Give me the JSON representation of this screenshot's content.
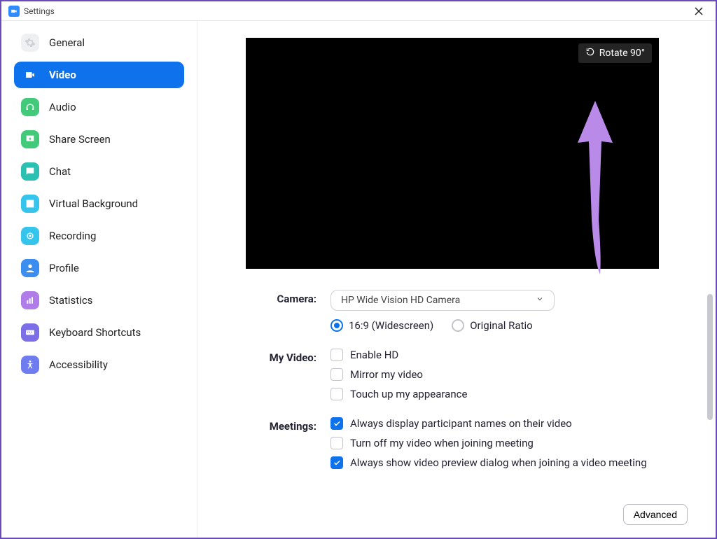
{
  "window": {
    "title": "Settings"
  },
  "sidebar": {
    "items": [
      {
        "key": "general",
        "label": "General"
      },
      {
        "key": "video",
        "label": "Video",
        "active": true
      },
      {
        "key": "audio",
        "label": "Audio"
      },
      {
        "key": "share",
        "label": "Share Screen"
      },
      {
        "key": "chat",
        "label": "Chat"
      },
      {
        "key": "vbg",
        "label": "Virtual Background"
      },
      {
        "key": "rec",
        "label": "Recording"
      },
      {
        "key": "profile",
        "label": "Profile"
      },
      {
        "key": "stats",
        "label": "Statistics"
      },
      {
        "key": "keys",
        "label": "Keyboard Shortcuts"
      },
      {
        "key": "access",
        "label": "Accessibility"
      }
    ]
  },
  "preview": {
    "rotate_label": "Rotate 90°"
  },
  "form": {
    "camera_label": "Camera:",
    "camera_value": "HP Wide Vision HD Camera",
    "ratio_widescreen": "16:9 (Widescreen)",
    "ratio_original": "Original Ratio",
    "myvideo_label": "My Video:",
    "enable_hd": "Enable HD",
    "mirror": "Mirror my video",
    "touchup": "Touch up my appearance",
    "meetings_label": "Meetings:",
    "always_names": "Always display participant names on their video",
    "turn_off": "Turn off my video when joining meeting",
    "always_preview": "Always show video preview dialog when joining a video meeting"
  },
  "buttons": {
    "advanced": "Advanced"
  }
}
